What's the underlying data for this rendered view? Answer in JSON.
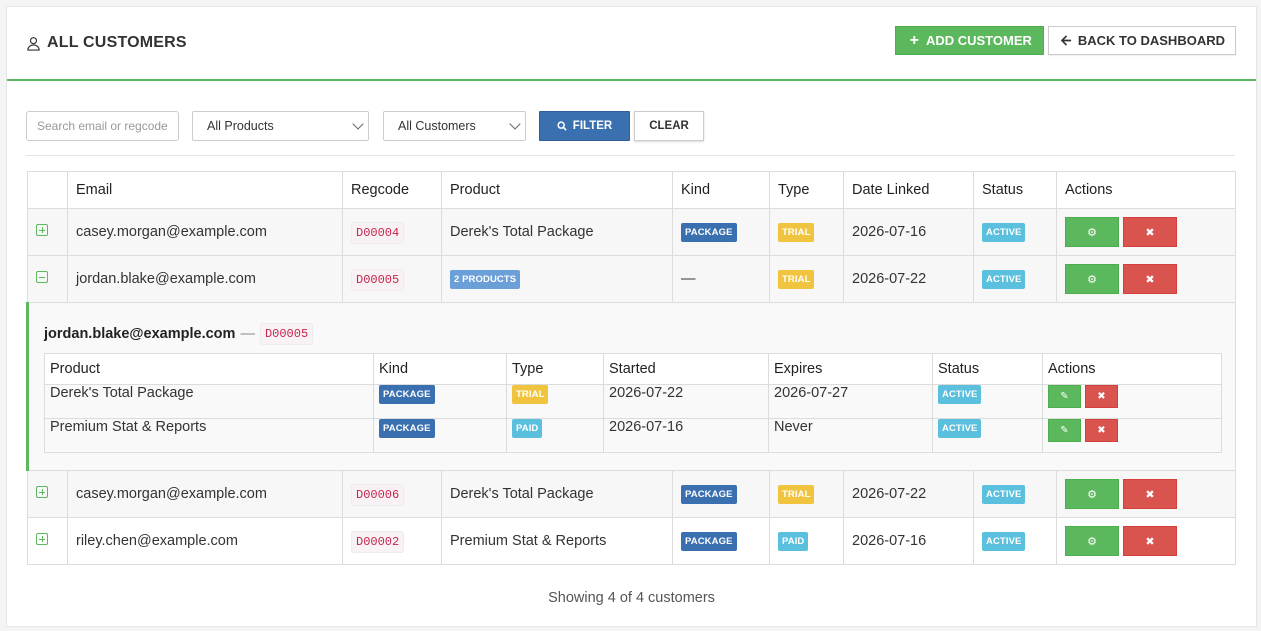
{
  "header": {
    "title": "ALL CUSTOMERS",
    "add_label": "ADD CUSTOMER",
    "back_label": "BACK TO DASHBOARD"
  },
  "filters": {
    "search_placeholder": "Search email or regcode",
    "product_select": "All Products",
    "customer_select": "All Customers",
    "filter_label": "FILTER",
    "clear_label": "CLEAR"
  },
  "table": {
    "headers": [
      "Email",
      "Regcode",
      "Product",
      "Kind",
      "Type",
      "Date Linked",
      "Status",
      "Actions"
    ],
    "rows": [
      {
        "email": "casey.morgan@example.com",
        "regcode": "D00004",
        "product": "Derek's Total Package",
        "kind": "PACKAGE",
        "type": "TRIAL",
        "date": "2026-07-16",
        "status": "ACTIVE"
      },
      {
        "email": "jordan.blake@example.com",
        "regcode": "D00005",
        "product": "2 PRODUCTS",
        "kind": "—",
        "type": "TRIAL",
        "date": "2026-07-22",
        "status": "ACTIVE"
      },
      {
        "email": "casey.morgan@example.com",
        "regcode": "D00006",
        "product": "Derek's Total Package",
        "kind": "PACKAGE",
        "type": "TRIAL",
        "date": "2026-07-22",
        "status": "ACTIVE"
      },
      {
        "email": "riley.chen@example.com",
        "regcode": "D00002",
        "product": "Premium Stat & Reports",
        "kind": "PACKAGE",
        "type": "PAID",
        "date": "2026-07-16",
        "status": "ACTIVE"
      }
    ]
  },
  "detail": {
    "email": "jordan.blake@example.com",
    "separator": "—",
    "regcode": "D00005",
    "headers": [
      "Product",
      "Kind",
      "Type",
      "Started",
      "Expires",
      "Status",
      "Actions"
    ],
    "rows": [
      {
        "product": "Derek's Total Package",
        "kind": "PACKAGE",
        "type": "TRIAL",
        "started": "2026-07-22",
        "expires": "2026-07-27",
        "status": "ACTIVE"
      },
      {
        "product": "Premium Stat & Reports",
        "kind": "PACKAGE",
        "type": "PAID",
        "started": "2026-07-16",
        "expires": "Never",
        "status": "ACTIVE"
      }
    ]
  },
  "footer": "Showing 4 of 4 customers",
  "icons": {
    "user": "user-icon",
    "plus": "plus-icon",
    "arrow": "arrow-left-icon",
    "search": "search-icon",
    "gear": "gear-icon",
    "times": "times-icon",
    "pencil": "pencil-icon"
  },
  "colors": {
    "green": "#5cb85c",
    "red": "#d9534f",
    "blue": "#3a6fb0",
    "light_blue": "#6a9fd8",
    "yellow": "#f0c43f",
    "cyan": "#5bc0de",
    "code_red": "#c7254e"
  }
}
